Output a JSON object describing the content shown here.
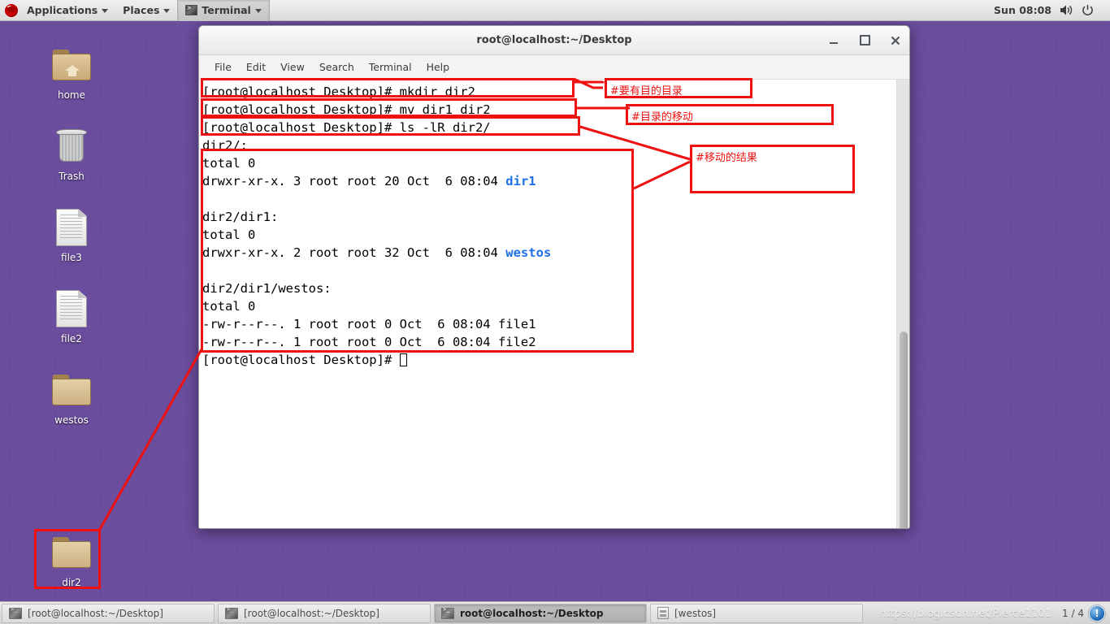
{
  "panel": {
    "logo_icon": "redhat-logo-icon",
    "applications_label": "Applications",
    "places_label": "Places",
    "active_app_label": "Terminal",
    "clock": "Sun 08:08",
    "volume_icon": "volume-icon",
    "power_icon": "power-icon",
    "caret_icon": "chevron-down-icon"
  },
  "desktop": {
    "background_color": "#6b4d9e",
    "icons": [
      {
        "label": "home",
        "type": "folder-home"
      },
      {
        "label": "Trash",
        "type": "trash"
      },
      {
        "label": "file3",
        "type": "document"
      },
      {
        "label": "file2",
        "type": "document"
      },
      {
        "label": "westos",
        "type": "folder"
      },
      {
        "label": "dir2",
        "type": "folder",
        "highlighted": true
      }
    ]
  },
  "terminal": {
    "title": "root@localhost:~/Desktop",
    "menus": [
      "File",
      "Edit",
      "View",
      "Search",
      "Terminal",
      "Help"
    ],
    "window_controls": {
      "minimize": "_",
      "maximize": "□",
      "close": "✕"
    },
    "prompt": "[root@localhost Desktop]#",
    "lines": [
      {
        "text": "[root@localhost Desktop]# mkdir dir2"
      },
      {
        "text": "[root@localhost Desktop]# mv dir1 dir2"
      },
      {
        "text": "[root@localhost Desktop]# ls -lR dir2/"
      },
      {
        "text": "dir2/:"
      },
      {
        "text": "total 0"
      },
      {
        "text": "drwxr-xr-x. 3 root root 20 Oct  6 08:04 ",
        "colored": "dir1"
      },
      {
        "text": ""
      },
      {
        "text": "dir2/dir1:"
      },
      {
        "text": "total 0"
      },
      {
        "text": "drwxr-xr-x. 2 root root 32 Oct  6 08:04 ",
        "colored": "westos"
      },
      {
        "text": ""
      },
      {
        "text": "dir2/dir1/westos:"
      },
      {
        "text": "total 0"
      },
      {
        "text": "-rw-r--r--. 1 root root 0 Oct  6 08:04 file1"
      },
      {
        "text": "-rw-r--r--. 1 root root 0 Oct  6 08:04 file2"
      },
      {
        "text": "[root@localhost Desktop]# ",
        "cursor": true
      }
    ]
  },
  "annotations": {
    "color": "#ee1111",
    "notes": [
      {
        "text": "#要有目的目录"
      },
      {
        "text": "#目录的移动"
      },
      {
        "text": "#移动的结果"
      }
    ]
  },
  "taskbar": {
    "items": [
      {
        "label": "[root@localhost:~/Desktop]",
        "icon": "terminal-icon",
        "active": false
      },
      {
        "label": "[root@localhost:~/Desktop]",
        "icon": "terminal-icon",
        "active": false
      },
      {
        "label": "root@localhost:~/Desktop",
        "icon": "terminal-icon",
        "active": true
      },
      {
        "label": "[westos]",
        "icon": "file-manager-icon",
        "active": false
      }
    ],
    "workspace": "1 / 4",
    "watermark": "https://blog.csdn.net/Pierce1101",
    "notify_icon": "info-circle-icon"
  }
}
